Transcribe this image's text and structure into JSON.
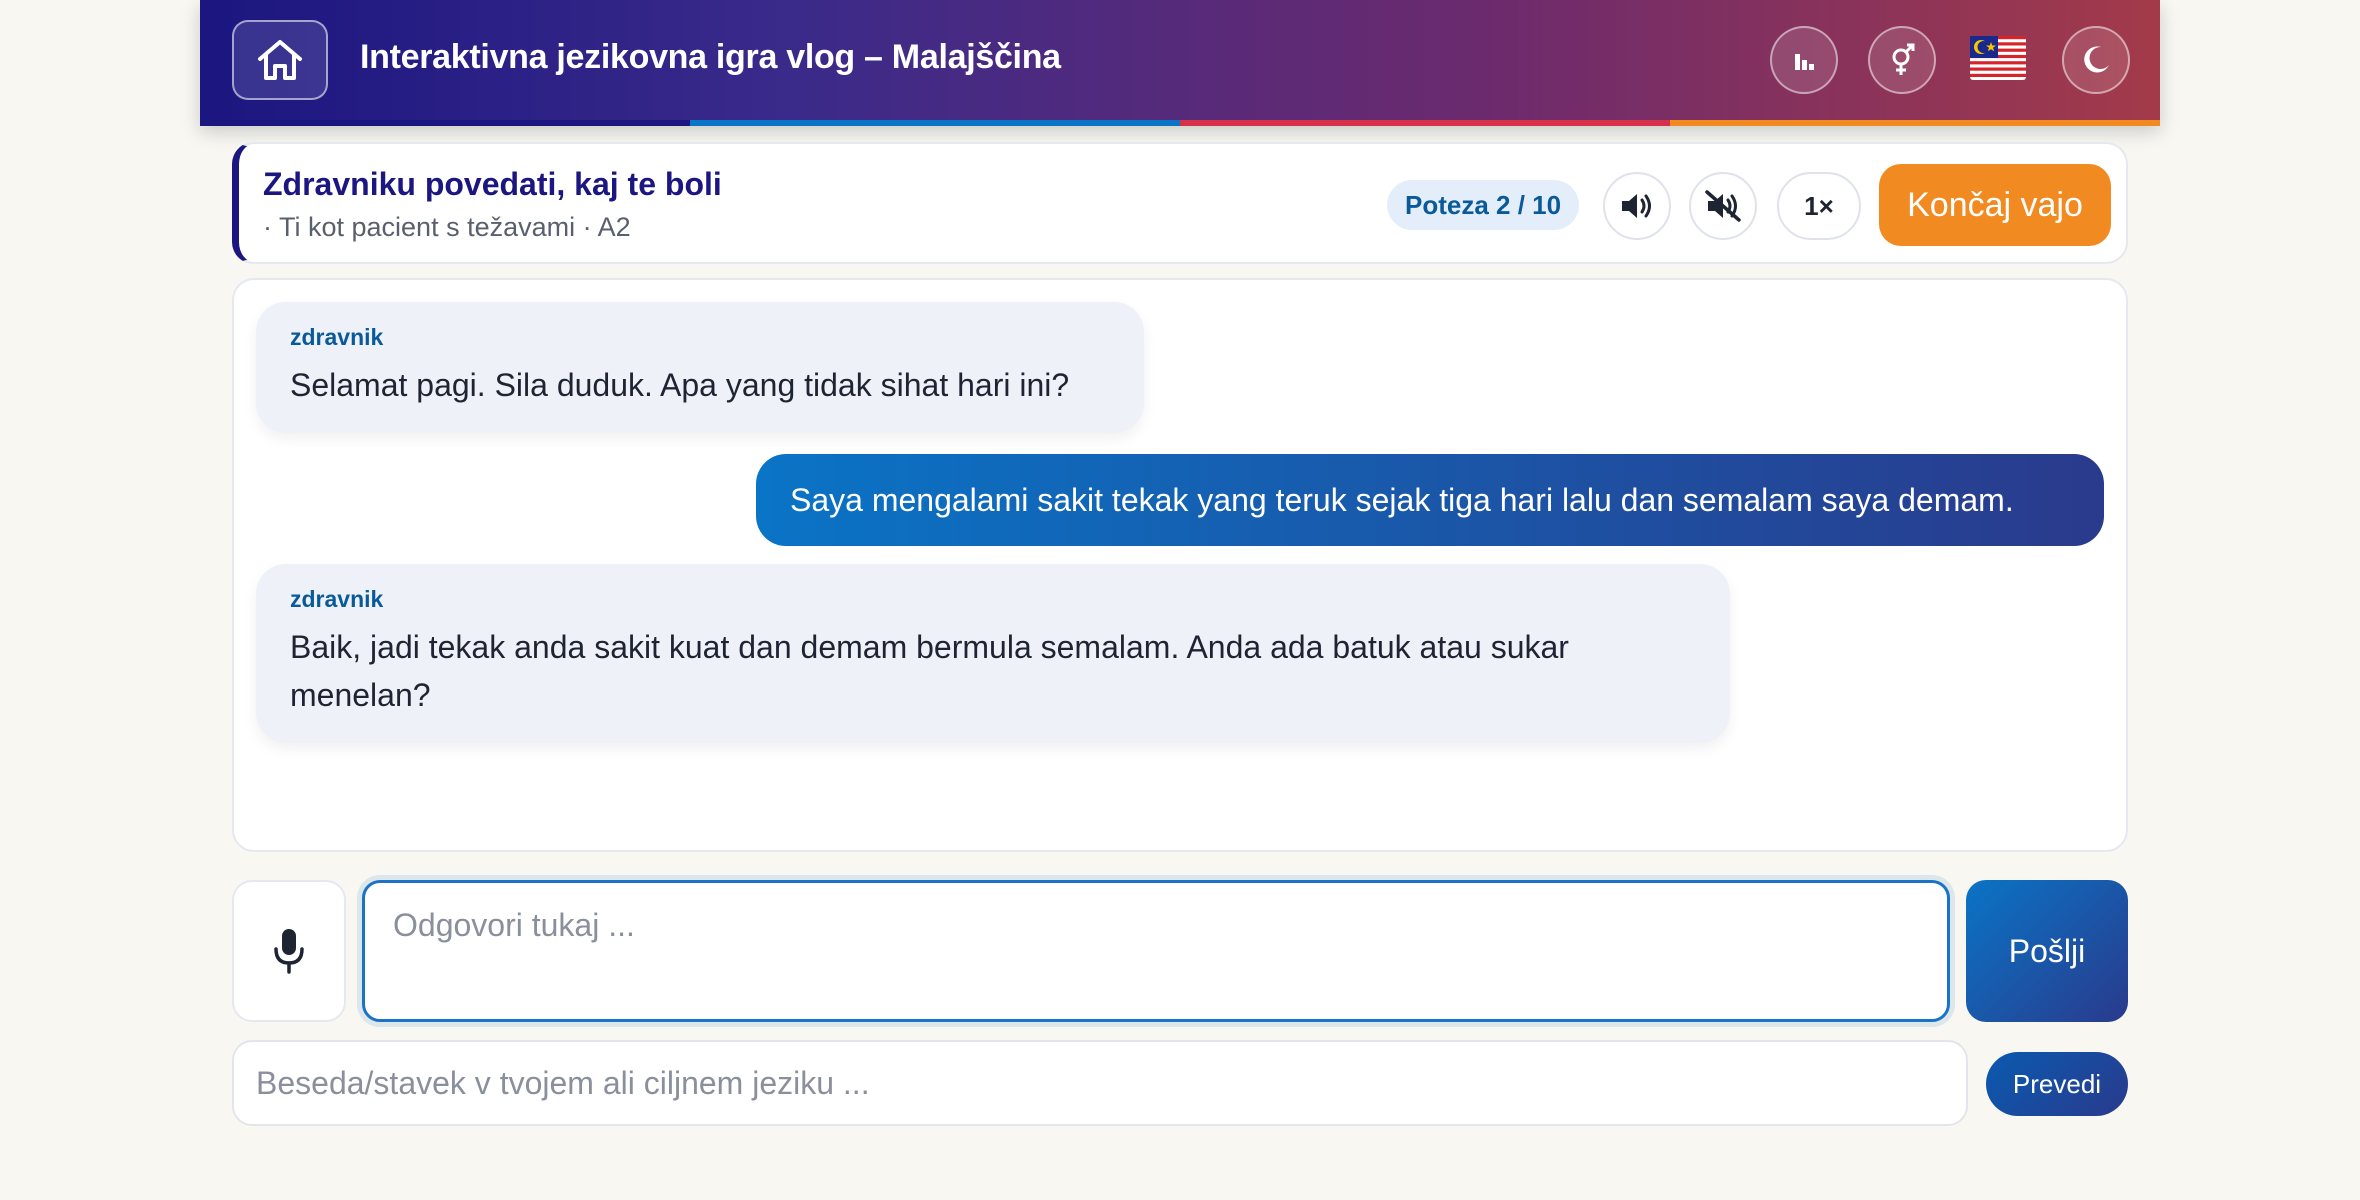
{
  "header": {
    "title": "Interaktivna jezikovna igra vlog – Malajščina",
    "home_icon": "home-icon",
    "stats_icon": "bar-chart-icon",
    "gender_icon": "gender-icon",
    "flag_icon": "malaysia-flag-icon",
    "theme_icon": "moon-icon",
    "stripe_colors": [
      "#1b1680",
      "#0a74c6",
      "#d6304a",
      "#f28a22"
    ]
  },
  "scenario": {
    "title": "Zdravniku povedati, kaj te boli",
    "subtitle": "· Ti kot pacient s težavami · A2",
    "turn": "Poteza 2 / 10",
    "sound_icon": "speaker-icon",
    "mute_icon": "speaker-off-icon",
    "speed": "1×",
    "end_label": "Končaj vajo"
  },
  "messages": [
    {
      "role": "partner",
      "speaker": "zdravnik",
      "text": "Selamat pagi. Sila duduk. Apa yang tidak sihat hari ini?"
    },
    {
      "role": "user",
      "text": "Saya mengalami sakit tekak yang teruk sejak tiga hari lalu dan semalam saya demam."
    },
    {
      "role": "partner",
      "speaker": "zdravnik",
      "text": "Baik, jadi tekak anda sakit kuat dan demam bermula semalam. Anda ada batuk atau sukar menelan?"
    }
  ],
  "composer": {
    "mic_icon": "microphone-icon",
    "placeholder": "Odgovori tukaj ...",
    "value": "",
    "send_label": "Pošlji"
  },
  "translator": {
    "placeholder": "Beseda/stavek v tvojem ali ciljnem jeziku ...",
    "value": "",
    "button_label": "Prevedi"
  },
  "colors": {
    "brand": "#1b1680",
    "accent": "#0a74c6",
    "orange": "#f28a22"
  }
}
